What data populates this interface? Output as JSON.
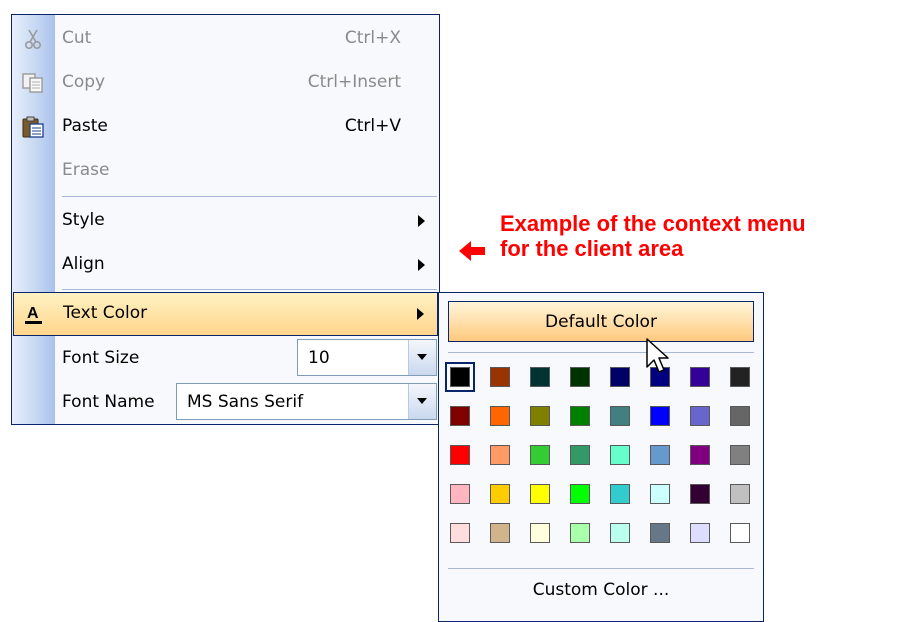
{
  "menu": {
    "cut": {
      "label": "Cut",
      "shortcut": "Ctrl+X"
    },
    "copy": {
      "label": "Copy",
      "shortcut": "Ctrl+Insert"
    },
    "paste": {
      "label": "Paste",
      "shortcut": "Ctrl+V"
    },
    "erase": {
      "label": "Erase"
    },
    "style": {
      "label": "Style"
    },
    "align": {
      "label": "Align"
    },
    "text_color": {
      "label": "Text Color"
    },
    "font_size": {
      "label": "Font Size",
      "value": "10"
    },
    "font_name": {
      "label": "Font Name",
      "value": "MS Sans Serif"
    }
  },
  "color_popup": {
    "default_label": "Default Color",
    "custom_label": "Custom Color ...",
    "selected_swatch": "#000000",
    "swatches": [
      [
        "#000000",
        "#993300",
        "#003333",
        "#003300",
        "#000066",
        "#000080",
        "#330099",
        "#222222"
      ],
      [
        "#800000",
        "#ff6600",
        "#808000",
        "#008000",
        "#408080",
        "#0000ff",
        "#6666cc",
        "#666666"
      ],
      [
        "#ff0000",
        "#ff9966",
        "#33cc33",
        "#339966",
        "#66ffcc",
        "#6699cc",
        "#800080",
        "#808080"
      ],
      [
        "#ffb6c1",
        "#ffcc00",
        "#ffff00",
        "#00ff00",
        "#33cccc",
        "#ccffff",
        "#330033",
        "#c0c0c0"
      ],
      [
        "#ffdddd",
        "#d2b48c",
        "#ffffdd",
        "#aaffaa",
        "#bbffee",
        "#667788",
        "#ddddff",
        "#ffffff"
      ]
    ]
  },
  "annotation": {
    "line1": "Example of the context menu",
    "line2": "for the client area",
    "color": "#ff0000"
  },
  "colors": {
    "accent_border": "#0a246a",
    "hover_bg": "#ffd58c"
  }
}
